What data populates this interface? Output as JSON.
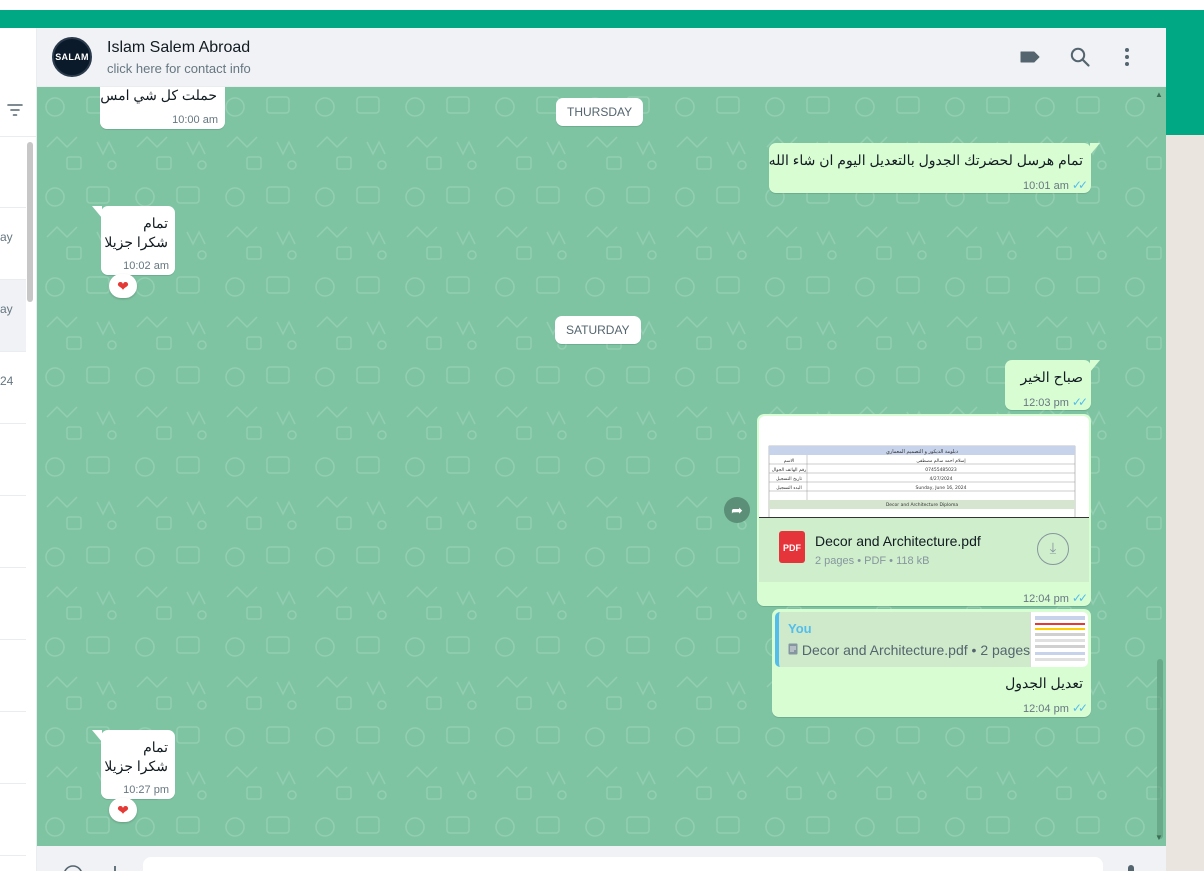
{
  "header": {
    "contact_name": "Islam Salem Abroad",
    "contact_sub": "click here for contact info",
    "avatar_text": "SALAM"
  },
  "sidebar_stub": {
    "row_fragments": [
      "ay",
      "ay",
      "24"
    ]
  },
  "chat": {
    "date_chips": [
      "THURSDAY",
      "SATURDAY"
    ],
    "messages": [
      {
        "dir": "in",
        "text": "حملت كل شي امس",
        "time": "10:00 am"
      },
      {
        "dir": "out",
        "text": "تمام هرسل لحضرتك الجدول بالتعديل اليوم ان شاء الله",
        "time": "10:01 am",
        "status": "read"
      },
      {
        "dir": "in",
        "line1": "تمام",
        "line2": "شكرا جزيلا",
        "time": "10:02 am",
        "reaction": "❤"
      },
      {
        "dir": "out",
        "text": "صباح الخير",
        "time": "12:03 pm",
        "status": "read"
      },
      {
        "dir": "out",
        "type": "document",
        "file_name": "Decor and Architecture.pdf",
        "file_info": "2 pages • PDF • 118 kB",
        "badge": "PDF",
        "time": "12:04 pm",
        "status": "read"
      },
      {
        "dir": "out",
        "type": "reply",
        "quote_author": "You",
        "quote_text": "Decor and Architecture.pdf • 2 pages",
        "text": "تعديل الجدول",
        "time": "12:04 pm",
        "status": "read"
      },
      {
        "dir": "in",
        "line1": "تمام",
        "line2": "شكرا جزيلا",
        "time": "10:27 pm",
        "reaction": "❤"
      }
    ]
  },
  "doc_preview": {
    "title": "دبلومة الديكور و التصميم المعماري",
    "rows": [
      {
        "label": "الاسم",
        "value": "إسلام احمد سالم مصطفى"
      },
      {
        "label": "رقم الهاتف الجوال",
        "value": "07455485023"
      },
      {
        "label": "تاريخ التسجيل",
        "value": "4/27/2024"
      },
      {
        "label": "البدء التسجيل",
        "value": "Sunday, June 16, 2024"
      }
    ],
    "section": "Decor and Architecture Diploma"
  },
  "colors": {
    "accent": "#00a884",
    "chat_bg": "#7ec4a2",
    "bubble_out": "#d9fdd3",
    "bubble_in": "#ffffff",
    "tick": "#53bdeb"
  },
  "icons": [
    "filter-icon",
    "label-icon",
    "search-icon",
    "menu-icon",
    "forward-icon",
    "download-icon",
    "file-icon",
    "emoji-icon",
    "attach-icon",
    "mic-icon"
  ]
}
